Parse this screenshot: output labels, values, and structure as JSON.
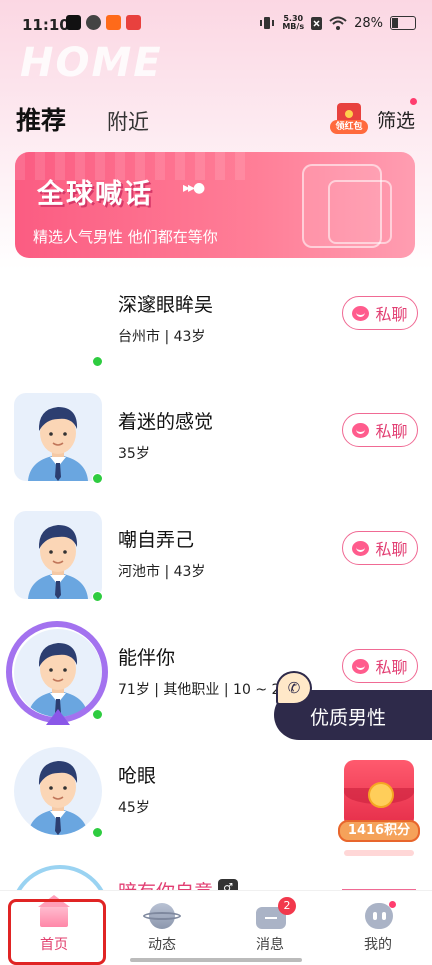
{
  "status_bar": {
    "time": "11:10",
    "net_speed_value": "5.30",
    "net_speed_unit": "MB/s",
    "battery": "28%"
  },
  "header": {
    "watermark": "HOME",
    "tab_recommend": "推荐",
    "tab_nearby": "附近",
    "red_packet_label": "领红包",
    "filter_label": "筛选"
  },
  "banner": {
    "title": "全球喊话",
    "subtitle": "精选人气男性 他们都在等你"
  },
  "users": [
    {
      "name": "深邃眼眸吴",
      "meta": "台州市 | 43岁",
      "chat_label": "私聊"
    },
    {
      "name": "着迷的感觉",
      "meta": "35岁",
      "chat_label": "私聊"
    },
    {
      "name": "嘲自弄己",
      "meta": "河池市 | 43岁",
      "chat_label": "私聊"
    },
    {
      "name": "能伴你",
      "meta": "71岁 | 其他职业 | 10 ~ 20",
      "chat_label": "私聊"
    },
    {
      "name": "呛眼",
      "meta": "45岁"
    }
  ],
  "partial_user": {
    "name": "暗有你自意"
  },
  "quality_badge": "优质男性",
  "points": {
    "label": "1416积分"
  },
  "tabbar": {
    "home": "首页",
    "moments": "动态",
    "messages": "消息",
    "messages_badge": "2",
    "me": "我的"
  },
  "colors": {
    "accent": "#e2416f",
    "banner": "#fb5c82",
    "online": "#2ecc40",
    "badge_dark": "#2e2a4a"
  }
}
